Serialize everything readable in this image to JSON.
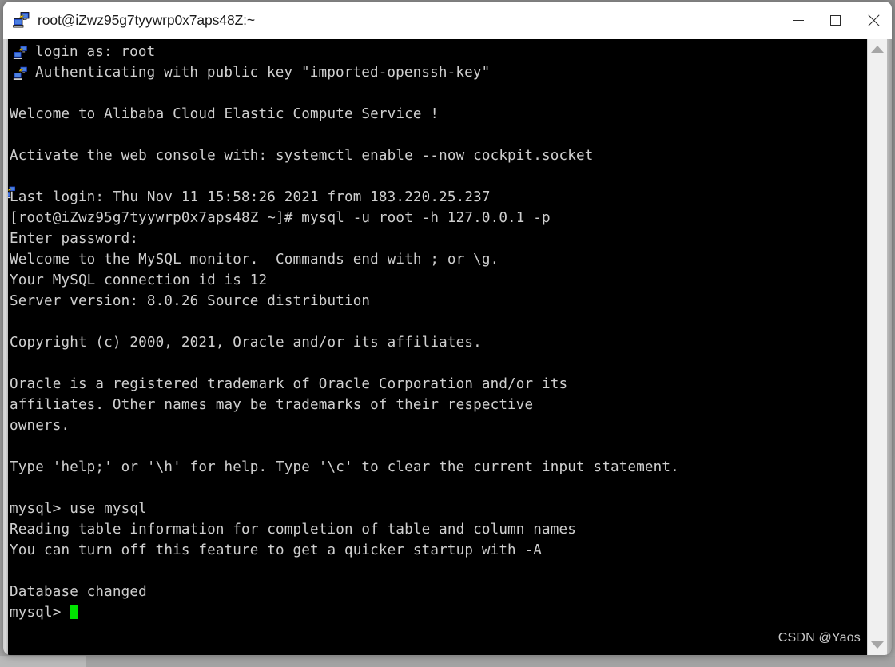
{
  "window": {
    "title": "root@iZwz95g7tyywrp0x7aps48Z:~",
    "icon": "putty-computer-icon",
    "controls": {
      "minimize_label": "Minimize",
      "maximize_label": "Maximize",
      "close_label": "Close"
    },
    "background_color": "#000000",
    "text_color": "#cfcfcf",
    "cursor_color": "#00e400"
  },
  "terminal": {
    "lines": [
      {
        "text": "login as: root",
        "indent": true
      },
      {
        "text": "Authenticating with public key \"imported-openssh-key\"",
        "indent": true
      },
      {
        "text": "",
        "indent": false
      },
      {
        "text": "Welcome to Alibaba Cloud Elastic Compute Service !",
        "indent": false
      },
      {
        "text": "",
        "indent": false
      },
      {
        "text": "Activate the web console with: systemctl enable --now cockpit.socket",
        "indent": false
      },
      {
        "text": "",
        "indent": false
      },
      {
        "text": "Last login: Thu Nov 11 15:58:26 2021 from 183.220.25.237",
        "indent": false
      },
      {
        "text": "[root@iZwz95g7tyywrp0x7aps48Z ~]# mysql -u root -h 127.0.0.1 -p",
        "indent": false
      },
      {
        "text": "Enter password:",
        "indent": false
      },
      {
        "text": "Welcome to the MySQL monitor.  Commands end with ; or \\g.",
        "indent": false
      },
      {
        "text": "Your MySQL connection id is 12",
        "indent": false
      },
      {
        "text": "Server version: 8.0.26 Source distribution",
        "indent": false
      },
      {
        "text": "",
        "indent": false
      },
      {
        "text": "Copyright (c) 2000, 2021, Oracle and/or its affiliates.",
        "indent": false
      },
      {
        "text": "",
        "indent": false
      },
      {
        "text": "Oracle is a registered trademark of Oracle Corporation and/or its",
        "indent": false
      },
      {
        "text": "affiliates. Other names may be trademarks of their respective",
        "indent": false
      },
      {
        "text": "owners.",
        "indent": false
      },
      {
        "text": "",
        "indent": false
      },
      {
        "text": "Type 'help;' or '\\h' for help. Type '\\c' to clear the current input statement.",
        "indent": false
      },
      {
        "text": "",
        "indent": false
      },
      {
        "text": "mysql> use mysql",
        "indent": false
      },
      {
        "text": "Reading table information for completion of table and column names",
        "indent": false
      },
      {
        "text": "You can turn off this feature to get a quicker startup with -A",
        "indent": false
      },
      {
        "text": "",
        "indent": false
      },
      {
        "text": "Database changed",
        "indent": false
      }
    ],
    "prompt": "mysql> ",
    "ghost_icons": [
      "putty-computer-icon",
      "putty-computer-icon",
      "putty-computer-icon",
      "putty-computer-icon",
      "putty-computer-icon"
    ]
  },
  "scrollbar": {
    "up_arrow": "triangle-up-icon",
    "down_arrow": "triangle-down-icon"
  },
  "watermark": {
    "text": "CSDN @Yaos"
  }
}
